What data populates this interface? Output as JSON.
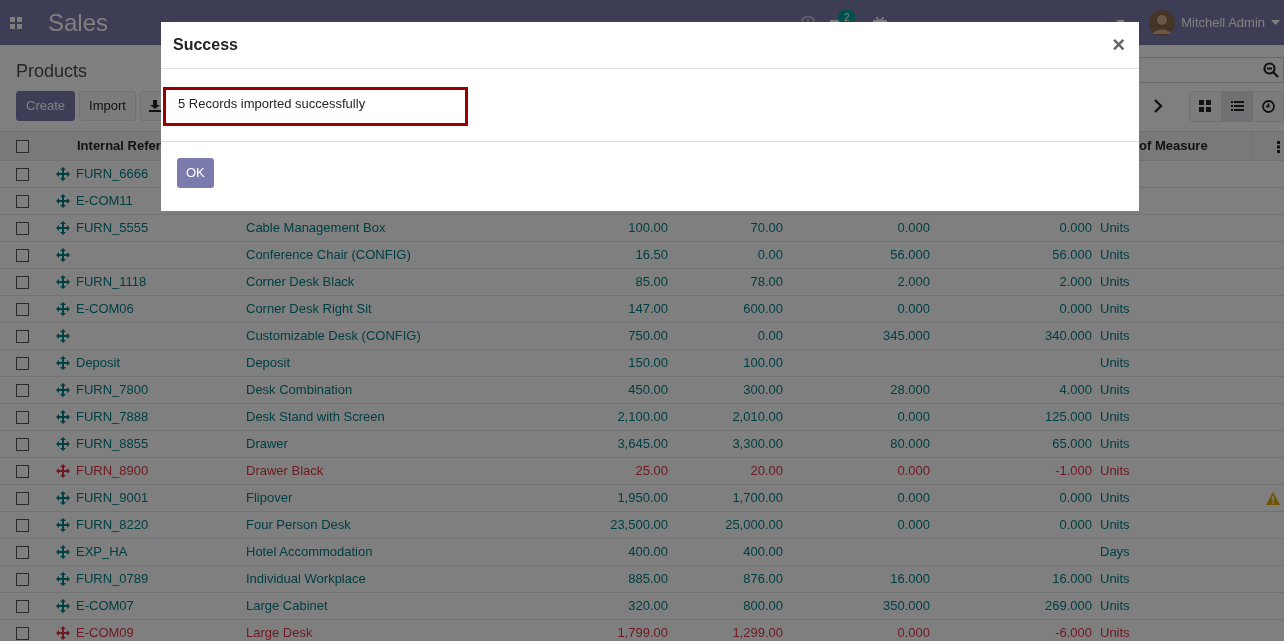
{
  "navbar": {
    "app_name": "Sales",
    "messages_badge": "2",
    "user": "Mitchell Admin"
  },
  "control_panel": {
    "title": "Products",
    "buttons": [
      "Create",
      "Import"
    ],
    "views": [
      {
        "kind": "kanban",
        "selected": false
      },
      {
        "kind": "list",
        "selected": true
      },
      {
        "kind": "activity",
        "selected": false
      }
    ]
  },
  "table": {
    "select_all": false,
    "columns": [
      "Internal Refer",
      "of Measure"
    ],
    "rows": [
      {
        "ref": "FURN_6666",
        "negative": false,
        "selected": false
      },
      {
        "ref": "E-COM11",
        "negative": false,
        "selected": false
      },
      {
        "ref": "FURN_5555",
        "name": "Cable Management Box",
        "price": "100.00",
        "cost": "70.00",
        "on_hand": "0.000",
        "forecast": "0.000",
        "uom": "Units",
        "negative": false,
        "selected": false
      },
      {
        "name": "Conference Chair (CONFIG)",
        "price": "16.50",
        "cost": "0.00",
        "on_hand": "56.000",
        "forecast": "56.000",
        "uom": "Units",
        "negative": false,
        "selected": false
      },
      {
        "ref": "FURN_1118",
        "name": "Corner Desk Black",
        "price": "85.00",
        "cost": "78.00",
        "on_hand": "2.000",
        "forecast": "2.000",
        "uom": "Units",
        "negative": false,
        "selected": false
      },
      {
        "ref": "E-COM06",
        "name": "Corner Desk Right Sit",
        "price": "147.00",
        "cost": "600.00",
        "on_hand": "0.000",
        "forecast": "0.000",
        "uom": "Units",
        "negative": false,
        "selected": false
      },
      {
        "name": "Customizable Desk (CONFIG)",
        "price": "750.00",
        "cost": "0.00",
        "on_hand": "345.000",
        "forecast": "340.000",
        "uom": "Units",
        "negative": false,
        "selected": false
      },
      {
        "ref": "Deposit",
        "name": "Deposit",
        "price": "150.00",
        "cost": "100.00",
        "uom": "Units",
        "negative": false,
        "selected": false
      },
      {
        "ref": "FURN_7800",
        "name": "Desk Combination",
        "price": "450.00",
        "cost": "300.00",
        "on_hand": "28.000",
        "forecast": "4.000",
        "uom": "Units",
        "negative": false,
        "selected": false
      },
      {
        "ref": "FURN_7888",
        "name": "Desk Stand with Screen",
        "price": "2,100.00",
        "cost": "2,010.00",
        "on_hand": "0.000",
        "forecast": "125.000",
        "uom": "Units",
        "negative": false,
        "selected": false
      },
      {
        "ref": "FURN_8855",
        "name": "Drawer",
        "price": "3,645.00",
        "cost": "3,300.00",
        "on_hand": "80.000",
        "forecast": "65.000",
        "uom": "Units",
        "negative": false,
        "selected": false
      },
      {
        "ref": "FURN_8900",
        "name": "Drawer Black",
        "price": "25.00",
        "cost": "20.00",
        "on_hand": "0.000",
        "forecast": "-1.000",
        "uom": "Units",
        "negative": true,
        "selected": false
      },
      {
        "ref": "FURN_9001",
        "name": "Flipover",
        "price": "1,950.00",
        "cost": "1,700.00",
        "on_hand": "0.000",
        "forecast": "0.000",
        "uom": "Units",
        "negative": false,
        "warning": true,
        "selected": false
      },
      {
        "ref": "FURN_8220",
        "name": "Four Person Desk",
        "price": "23,500.00",
        "cost": "25,000.00",
        "on_hand": "0.000",
        "forecast": "0.000",
        "uom": "Units",
        "negative": false,
        "selected": false
      },
      {
        "ref": "EXP_HA",
        "name": "Hotel Accommodation",
        "price": "400.00",
        "cost": "400.00",
        "uom": "Days",
        "negative": false,
        "selected": false
      },
      {
        "ref": "FURN_0789",
        "name": "Individual Workplace",
        "price": "885.00",
        "cost": "876.00",
        "on_hand": "16.000",
        "forecast": "16.000",
        "uom": "Units",
        "negative": false,
        "selected": false
      },
      {
        "ref": "E-COM07",
        "name": "Large Cabinet",
        "price": "320.00",
        "cost": "800.00",
        "on_hand": "350.000",
        "forecast": "269.000",
        "uom": "Units",
        "negative": false,
        "selected": false
      },
      {
        "ref": "E-COM09",
        "name": "Large Desk",
        "price": "1,799.00",
        "cost": "1,299.00",
        "on_hand": "0.000",
        "forecast": "-6.000",
        "uom": "Units",
        "negative": true,
        "selected": false
      }
    ]
  },
  "dialog": {
    "title": "Success",
    "close": "×",
    "message": "5 Records imported successfully",
    "button": "OK"
  }
}
